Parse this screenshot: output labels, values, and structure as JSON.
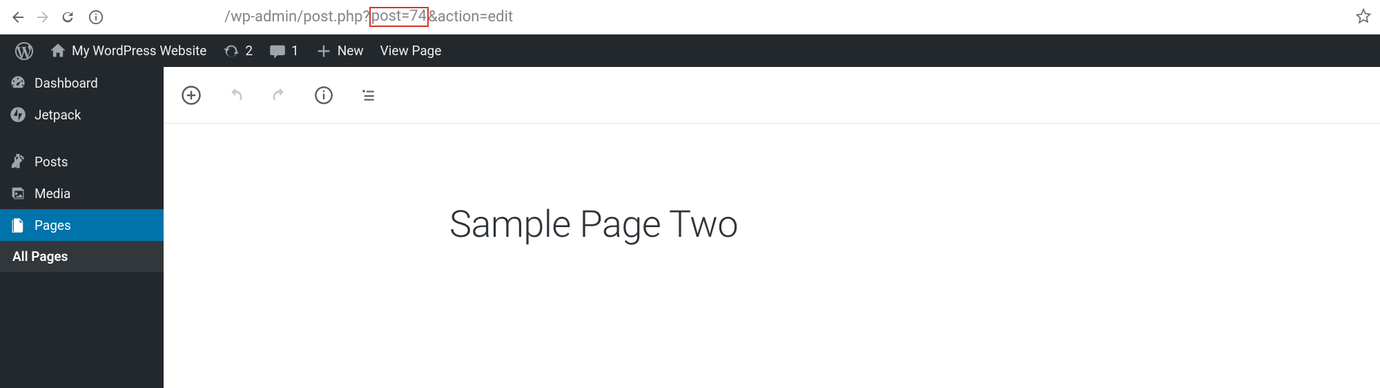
{
  "browser": {
    "url_prefix": "/wp-admin/post.php?",
    "url_highlight": "post=74",
    "url_suffix": "&action=edit"
  },
  "adminbar": {
    "site_title": "My WordPress Website",
    "updates_count": "2",
    "comments_count": "1",
    "new_label": "New",
    "view_label": "View Page"
  },
  "sidebar": {
    "items": [
      {
        "label": "Dashboard"
      },
      {
        "label": "Jetpack"
      },
      {
        "label": "Posts"
      },
      {
        "label": "Media"
      },
      {
        "label": "Pages"
      }
    ],
    "submenu": {
      "all_pages": "All Pages"
    }
  },
  "editor": {
    "title": "Sample Page Two"
  }
}
